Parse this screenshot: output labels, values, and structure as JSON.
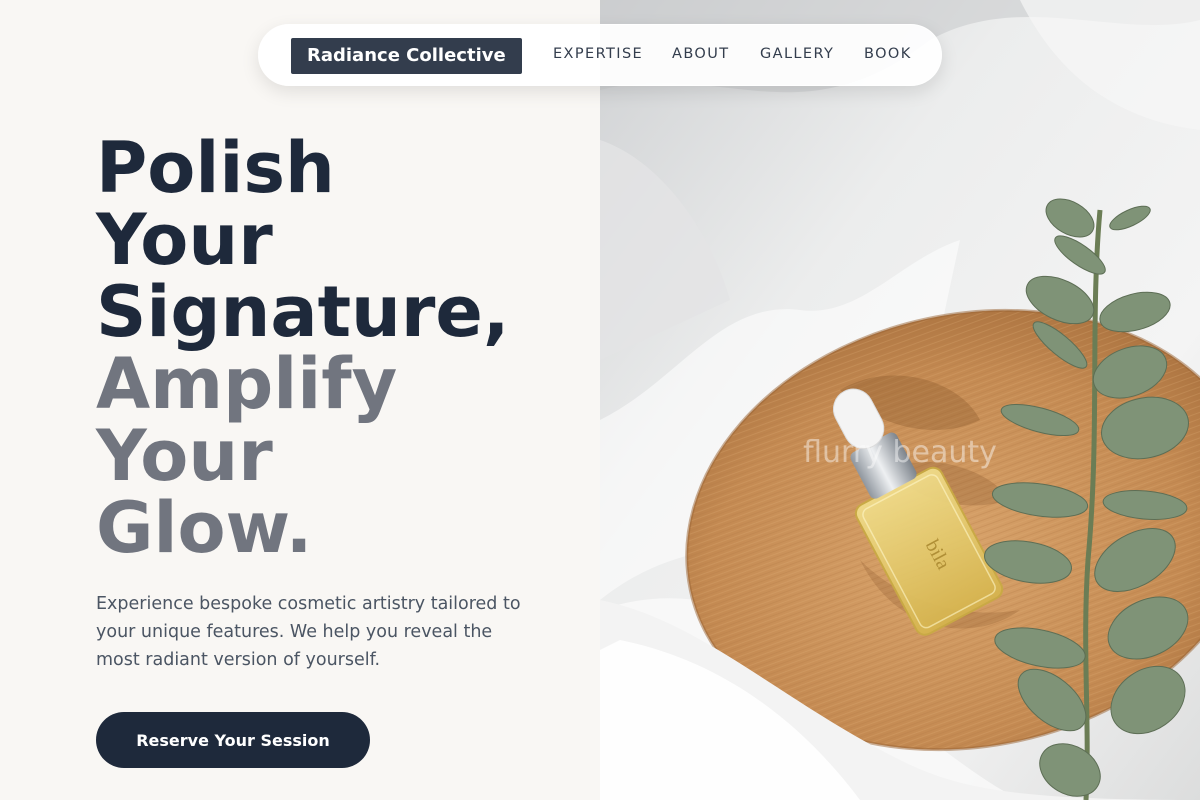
{
  "nav": {
    "brand": "Radiance Collective",
    "links": [
      "EXPERTISE",
      "ABOUT",
      "GALLERY",
      "BOOK"
    ]
  },
  "hero": {
    "headline_dark": [
      "Polish",
      "Your",
      "Signature,"
    ],
    "headline_muted": [
      "Amplify",
      "Your",
      "Glow."
    ],
    "description": "Experience bespoke cosmetic artistry tailored to your unique features. We help you reveal the most radiant version of yourself.",
    "cta_label": "Reserve Your Session"
  },
  "photo": {
    "watermark": "flurry beauty",
    "bottle_label": "bila"
  },
  "colors": {
    "primary": "#1e293b",
    "muted_text": "#71757f",
    "background": "#f9f7f4",
    "brand_bg": "#333d4d"
  }
}
